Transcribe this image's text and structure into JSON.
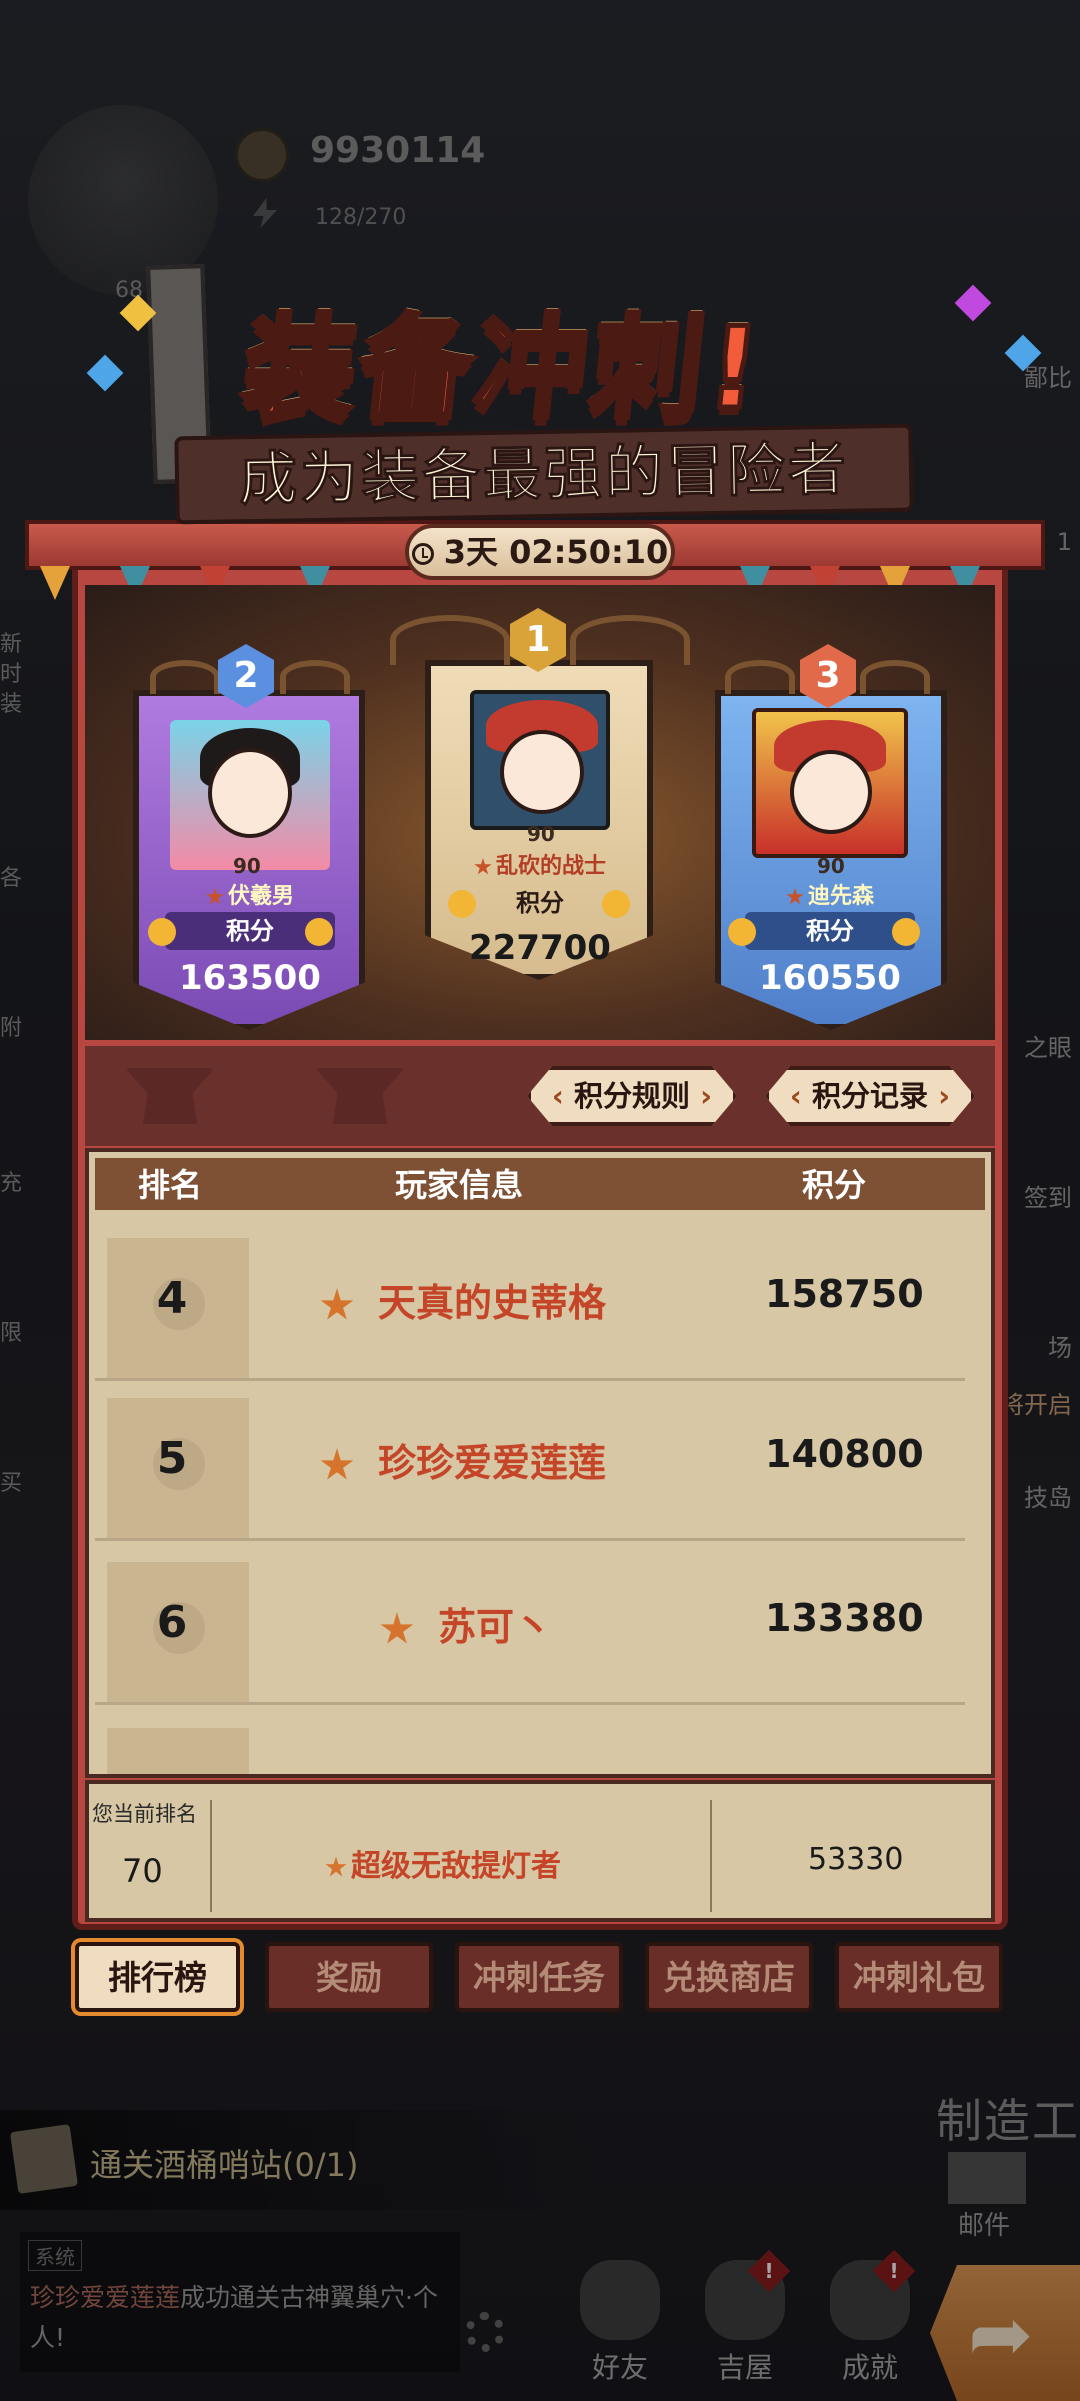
{
  "hud": {
    "gold": "9930114",
    "energy": "128/270",
    "level": "68",
    "left_labels": [
      "新",
      "时",
      "装",
      "各",
      "附",
      "充",
      "限",
      "买"
    ],
    "right_labels": [
      "鄙比",
      "1",
      "之眼",
      "签到",
      "场",
      "将开启",
      "技岛"
    ]
  },
  "event": {
    "title": "装备冲刺!",
    "subtitle": "成为装备最强的冒险者",
    "countdown": "3天 02:50:10"
  },
  "podium": [
    {
      "rank": "2",
      "level": "90",
      "name": "伏羲男",
      "score_label": "积分",
      "score": "163500"
    },
    {
      "rank": "1",
      "level": "90",
      "name": "乱砍的战士",
      "score_label": "积分",
      "score": "227700"
    },
    {
      "rank": "3",
      "level": "90",
      "name": "迪先森",
      "score_label": "积分",
      "score": "160550"
    }
  ],
  "buttons": {
    "rules": "积分规则",
    "records": "积分记录"
  },
  "table": {
    "headers": {
      "rank": "排名",
      "player": "玩家信息",
      "score": "积分"
    },
    "rows": [
      {
        "rank": "4",
        "name": "天真的史蒂格",
        "score": "158750"
      },
      {
        "rank": "5",
        "name": "珍珍爱爱莲莲",
        "score": "140800"
      },
      {
        "rank": "6",
        "name": "苏可丶",
        "score": "133380"
      }
    ]
  },
  "my_rank": {
    "label": "您当前排名",
    "rank": "70",
    "name": "超级无敌提灯者",
    "score": "53330"
  },
  "tabs": [
    "排行榜",
    "奖励",
    "冲刺任务",
    "兑换商店",
    "冲刺礼包"
  ],
  "bottom": {
    "task": "通关酒桶哨站(0/1)",
    "system_tag": "系统",
    "system_msg_name": "珍珍爱爱莲莲",
    "system_msg_rest": "成功通关古神翼巢穴·个人!",
    "craft": "制造工",
    "mail": "邮件",
    "nav": [
      "好友",
      "吉屋",
      "成就"
    ],
    "badge": "!"
  },
  "colors": {
    "panel_red": "#b74740",
    "accent_orange": "#e58a2f",
    "name_red": "#c44528",
    "parchment": "#d7c7a4"
  }
}
